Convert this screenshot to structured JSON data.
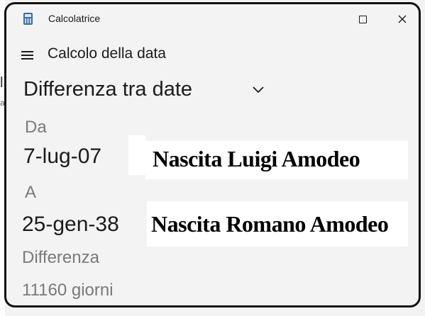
{
  "window": {
    "app_title": "Calcolatrice"
  },
  "header": {
    "page_title": "Calcolo della data"
  },
  "mode": {
    "selected": "Differenza tra date"
  },
  "from": {
    "label": "Da",
    "value": "7-lug-07",
    "note": "Nascita Luigi Amodeo"
  },
  "to": {
    "label": "A",
    "value": "25-gen-38",
    "note": "Nascita Romano Amodeo"
  },
  "difference": {
    "label": "Differenza",
    "value": "11160 giorni"
  },
  "background_fragments": {
    "left_1": "l",
    "left_2": "a"
  },
  "icons": {
    "app": "calculator-icon",
    "maximize": "maximize-icon",
    "close": "close-icon",
    "menu": "hamburger-menu-icon",
    "dropdown": "chevron-down-icon"
  }
}
